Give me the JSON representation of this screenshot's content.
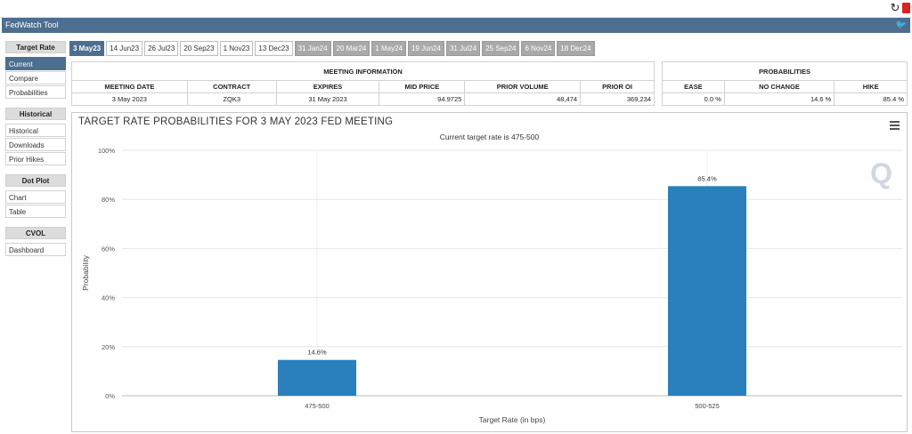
{
  "app_title": "FedWatch Tool",
  "icons": {
    "refresh": "refresh-icon",
    "pdf": "pdf-icon",
    "twitter": "twitter-icon",
    "menu": "hamburger-menu-icon",
    "logo": "quikstrike-q-logo"
  },
  "colors": {
    "titlebar": "#4d6e8f",
    "bar": "#2a7fbd",
    "tab_grey": "#a9a9a9"
  },
  "sidebar": {
    "sections": [
      {
        "title": "Target Rate",
        "items": [
          "Current",
          "Compare",
          "Probabilities"
        ]
      },
      {
        "title": "Historical",
        "items": [
          "Historical",
          "Downloads",
          "Prior Hikes"
        ]
      },
      {
        "title": "Dot Plot",
        "items": [
          "Chart",
          "Table"
        ]
      },
      {
        "title": "CVOL",
        "items": [
          "Dashboard"
        ]
      }
    ],
    "active_item": "Current"
  },
  "tabs": [
    {
      "label": "3 May23",
      "state": "active"
    },
    {
      "label": "14 Jun23",
      "state": "normal"
    },
    {
      "label": "26 Jul23",
      "state": "normal"
    },
    {
      "label": "20 Sep23",
      "state": "normal"
    },
    {
      "label": "1 Nov23",
      "state": "normal"
    },
    {
      "label": "13 Dec23",
      "state": "normal"
    },
    {
      "label": "31 Jan24",
      "state": "grey"
    },
    {
      "label": "20 Mar24",
      "state": "grey"
    },
    {
      "label": "1 May24",
      "state": "grey"
    },
    {
      "label": "19 Jun24",
      "state": "grey"
    },
    {
      "label": "31 Jul24",
      "state": "grey"
    },
    {
      "label": "25 Sep24",
      "state": "grey"
    },
    {
      "label": "6 Nov24",
      "state": "grey"
    },
    {
      "label": "18 Dec24",
      "state": "grey"
    }
  ],
  "meeting_info": {
    "header": "MEETING INFORMATION",
    "columns": [
      "MEETING DATE",
      "CONTRACT",
      "EXPIRES",
      "MID PRICE",
      "PRIOR VOLUME",
      "PRIOR OI"
    ],
    "row": [
      "3 May 2023",
      "ZQK3",
      "31 May 2023",
      "94.9725",
      "48,474",
      "369,234"
    ]
  },
  "probabilities": {
    "header": "PROBABILITIES",
    "columns": [
      "EASE",
      "NO CHANGE",
      "HIKE"
    ],
    "row": [
      "0.0 %",
      "14.6 %",
      "85.4 %"
    ]
  },
  "chart_data": {
    "type": "bar",
    "title": "TARGET RATE PROBABILITIES FOR 3 MAY 2023 FED MEETING",
    "subtitle": "Current target rate is 475-500",
    "xlabel": "Target Rate (in bps)",
    "ylabel": "Probability",
    "categories": [
      "475-500",
      "500-525"
    ],
    "values": [
      14.6,
      85.4
    ],
    "data_labels": [
      "14.6%",
      "85.4%"
    ],
    "ylim": [
      0,
      100
    ],
    "yticks": [
      0,
      20,
      40,
      60,
      80,
      100
    ],
    "ytick_labels": [
      "0%",
      "20%",
      "40%",
      "60%",
      "80%",
      "100%"
    ],
    "grid": true,
    "legend": "none"
  }
}
